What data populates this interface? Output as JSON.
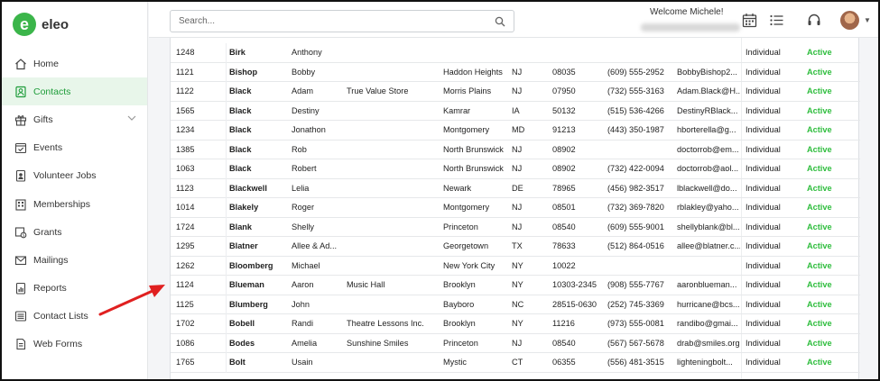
{
  "app": {
    "logo_letter": "e",
    "logo_text": "eleo"
  },
  "sidebar": {
    "items": [
      {
        "label": "Home",
        "icon": "home-icon"
      },
      {
        "label": "Contacts",
        "icon": "contacts-icon",
        "active": true
      },
      {
        "label": "Gifts",
        "icon": "gift-icon",
        "expandable": true
      },
      {
        "label": "Events",
        "icon": "calendar-check-icon"
      },
      {
        "label": "Volunteer Jobs",
        "icon": "person-badge-icon"
      },
      {
        "label": "Memberships",
        "icon": "building-icon"
      },
      {
        "label": "Grants",
        "icon": "grant-icon"
      },
      {
        "label": "Mailings",
        "icon": "envelope-icon"
      },
      {
        "label": "Reports",
        "icon": "report-icon"
      },
      {
        "label": "Contact Lists",
        "icon": "list-icon"
      },
      {
        "label": "Web Forms",
        "icon": "form-icon"
      }
    ]
  },
  "header": {
    "search_placeholder": "Search...",
    "welcome": "Welcome Michele!"
  },
  "colors": {
    "brand": "#3bb54a",
    "active_status": "#2ebd3d",
    "arrow": "#e02020"
  },
  "table": {
    "rows": [
      {
        "id": "1248",
        "last": "Birk",
        "first": "Anthony",
        "org": "",
        "city": "",
        "state": "",
        "zip": "",
        "phone": "",
        "email": "",
        "type": "Individual",
        "status": "Active"
      },
      {
        "id": "1121",
        "last": "Bishop",
        "first": "Bobby",
        "org": "",
        "city": "Haddon Heights",
        "state": "NJ",
        "zip": "08035",
        "phone": "(609) 555-2952",
        "email": "BobbyBishop2...",
        "type": "Individual",
        "status": "Active"
      },
      {
        "id": "1122",
        "last": "Black",
        "first": "Adam",
        "org": "True Value Store",
        "city": "Morris Plains",
        "state": "NJ",
        "zip": "07950",
        "phone": "(732) 555-3163",
        "email": "Adam.Black@H...",
        "type": "Individual",
        "status": "Active"
      },
      {
        "id": "1565",
        "last": "Black",
        "first": "Destiny",
        "org": "",
        "city": "Kamrar",
        "state": "IA",
        "zip": "50132",
        "phone": "(515) 536-4266",
        "email": "DestinyRBlack...",
        "type": "Individual",
        "status": "Active"
      },
      {
        "id": "1234",
        "last": "Black",
        "first": "Jonathon",
        "org": "",
        "city": "Montgomery",
        "state": "MD",
        "zip": "91213",
        "phone": "(443) 350-1987",
        "email": "hborterella@g...",
        "type": "Individual",
        "status": "Active"
      },
      {
        "id": "1385",
        "last": "Black",
        "first": "Rob",
        "org": "",
        "city": "North Brunswick",
        "state": "NJ",
        "zip": "08902",
        "phone": "",
        "email": "doctorrob@em...",
        "type": "Individual",
        "status": "Active"
      },
      {
        "id": "1063",
        "last": "Black",
        "first": "Robert",
        "org": "",
        "city": "North Brunswick",
        "state": "NJ",
        "zip": "08902",
        "phone": "(732) 422-0094",
        "email": "doctorrob@aol...",
        "type": "Individual",
        "status": "Active"
      },
      {
        "id": "1123",
        "last": "Blackwell",
        "first": "Lelia",
        "org": "",
        "city": "Newark",
        "state": "DE",
        "zip": "78965",
        "phone": "(456) 982-3517",
        "email": "lblackwell@do...",
        "type": "Individual",
        "status": "Active"
      },
      {
        "id": "1014",
        "last": "Blakely",
        "first": "Roger",
        "org": "",
        "city": "Montgomery",
        "state": "NJ",
        "zip": "08501",
        "phone": "(732) 369-7820",
        "email": "rblakley@yaho...",
        "type": "Individual",
        "status": "Active"
      },
      {
        "id": "1724",
        "last": "Blank",
        "first": "Shelly",
        "org": "",
        "city": "Princeton",
        "state": "NJ",
        "zip": "08540",
        "phone": "(609) 555-9001",
        "email": "shellyblank@bl...",
        "type": "Individual",
        "status": "Active"
      },
      {
        "id": "1295",
        "last": "Blatner",
        "first": "Allee & Ad...",
        "org": "",
        "city": "Georgetown",
        "state": "TX",
        "zip": "78633",
        "phone": "(512) 864-0516",
        "email": "allee@blatner.c...",
        "type": "Individual",
        "status": "Active"
      },
      {
        "id": "1262",
        "last": "Bloomberg",
        "first": "Michael",
        "org": "",
        "city": "New York City",
        "state": "NY",
        "zip": "10022",
        "phone": "",
        "email": "",
        "type": "Individual",
        "status": "Active"
      },
      {
        "id": "1124",
        "last": "Blueman",
        "first": "Aaron",
        "org": "Music Hall",
        "city": "Brooklyn",
        "state": "NY",
        "zip": "10303-2345",
        "phone": "(908) 555-7767",
        "email": "aaronblueman...",
        "type": "Individual",
        "status": "Active"
      },
      {
        "id": "1125",
        "last": "Blumberg",
        "first": "John",
        "org": "",
        "city": "Bayboro",
        "state": "NC",
        "zip": "28515-0630",
        "phone": "(252) 745-3369",
        "email": "hurricane@bcs...",
        "type": "Individual",
        "status": "Active"
      },
      {
        "id": "1702",
        "last": "Bobell",
        "first": "Randi",
        "org": "Theatre Lessons Inc.",
        "city": "Brooklyn",
        "state": "NY",
        "zip": "11216",
        "phone": "(973) 555-0081",
        "email": "randibo@gmai...",
        "type": "Individual",
        "status": "Active"
      },
      {
        "id": "1086",
        "last": "Bodes",
        "first": "Amelia",
        "org": "Sunshine Smiles",
        "city": "Princeton",
        "state": "NJ",
        "zip": "08540",
        "phone": "(567) 567-5678",
        "email": "drab@smiles.org",
        "type": "Individual",
        "status": "Active"
      },
      {
        "id": "1765",
        "last": "Bolt",
        "first": "Usain",
        "org": "",
        "city": "Mystic",
        "state": "CT",
        "zip": "06355",
        "phone": "(556) 481-3515",
        "email": "lighteningbolt...",
        "type": "Individual",
        "status": "Active"
      }
    ]
  }
}
